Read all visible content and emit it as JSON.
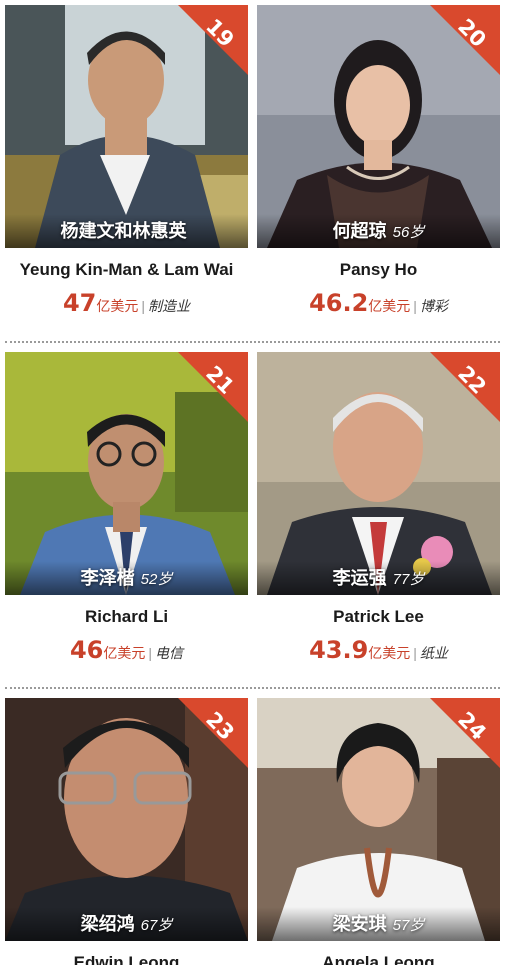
{
  "accent_color": "#c8412a",
  "rows": [
    {
      "cards": [
        {
          "rank": "19",
          "caption_name": "杨建文和林惠英",
          "age": "",
          "name": "Yeung Kin-Man & Lam Wai",
          "worth": "47",
          "unit": "亿美元",
          "industry": "制造业"
        },
        {
          "rank": "20",
          "caption_name": "何超琼",
          "age": "56岁",
          "name": "Pansy Ho",
          "worth": "46.2",
          "unit": "亿美元",
          "industry": "博彩"
        }
      ]
    },
    {
      "cards": [
        {
          "rank": "21",
          "caption_name": "李泽楷",
          "age": "52岁",
          "name": "Richard Li",
          "worth": "46",
          "unit": "亿美元",
          "industry": "电信"
        },
        {
          "rank": "22",
          "caption_name": "李运强",
          "age": "77岁",
          "name": "Patrick Lee",
          "worth": "43.9",
          "unit": "亿美元",
          "industry": "纸业"
        }
      ]
    },
    {
      "cards": [
        {
          "rank": "23",
          "caption_name": "梁绍鸿",
          "age": "67岁",
          "name": "Edwin Leong",
          "worth": "",
          "unit": "",
          "industry": ""
        },
        {
          "rank": "24",
          "caption_name": "梁安琪",
          "age": "57岁",
          "name": "Angela Leong",
          "worth": "",
          "unit": "",
          "industry": ""
        }
      ]
    }
  ]
}
